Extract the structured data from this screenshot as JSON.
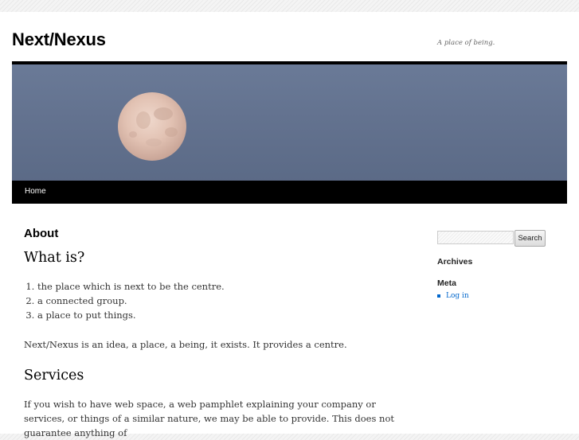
{
  "site": {
    "title": "Next/Nexus",
    "description": "A place of being."
  },
  "header": {
    "image": "full-moon-twilight-sky"
  },
  "nav": {
    "items": [
      {
        "label": "Home"
      }
    ]
  },
  "content": {
    "page_title": "About",
    "heading_1": "What is?",
    "definitions": [
      "the place which is next to be the centre.",
      "a connected group.",
      "a place to put things."
    ],
    "intro": "Next/Nexus is an idea, a place, a being, it exists. It provides a centre.",
    "heading_2": "Services",
    "services_text": "If you wish to have web space, a web pamphlet explaining your company or services, or things of a similar nature, we may be able to provide. This does not guarantee anything of"
  },
  "sidebar": {
    "search": {
      "placeholder": "",
      "button_label": "Search"
    },
    "archives_title": "Archives",
    "meta_title": "Meta",
    "meta_links": [
      {
        "label": "Log in"
      }
    ]
  },
  "colors": {
    "link": "#0066cc",
    "nav_background": "#000000",
    "sky": "#63728f"
  }
}
